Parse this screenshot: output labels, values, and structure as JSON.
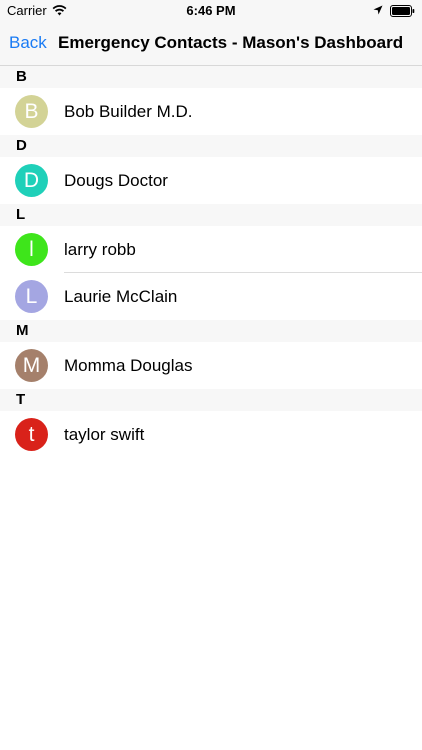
{
  "status_bar": {
    "carrier": "Carrier",
    "time": "6:46 PM",
    "icons": [
      "wifi-icon",
      "location-arrow-icon",
      "battery-icon"
    ]
  },
  "nav": {
    "back_label": "Back",
    "title": "Emergency Contacts - Mason's Dashboard"
  },
  "accent_color": "#1a7bf4",
  "sections": [
    {
      "letter": "B",
      "contacts": [
        {
          "initial": "B",
          "name": "Bob Builder M.D.",
          "color": "#d3d396"
        }
      ]
    },
    {
      "letter": "D",
      "contacts": [
        {
          "initial": "D",
          "name": "Dougs Doctor",
          "color": "#1fd0b9"
        }
      ]
    },
    {
      "letter": "L",
      "contacts": [
        {
          "initial": "l",
          "name": "larry robb",
          "color": "#3ee51b"
        },
        {
          "initial": "L",
          "name": "Laurie McClain",
          "color": "#a4a6e2"
        }
      ]
    },
    {
      "letter": "M",
      "contacts": [
        {
          "initial": "M",
          "name": "Momma Douglas",
          "color": "#a5806b"
        }
      ]
    },
    {
      "letter": "T",
      "contacts": [
        {
          "initial": "t",
          "name": "taylor swift",
          "color": "#d9221a"
        }
      ]
    }
  ]
}
